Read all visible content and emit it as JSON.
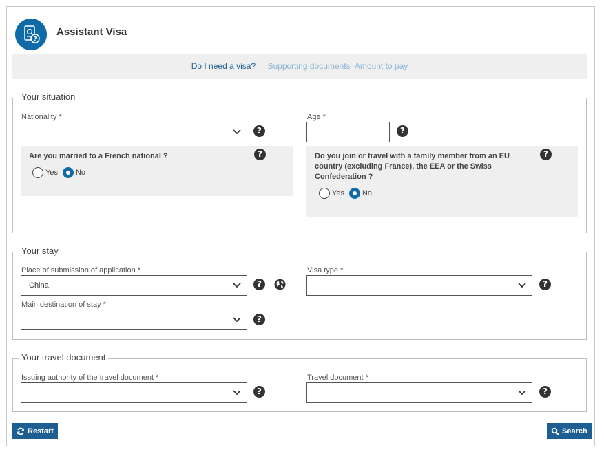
{
  "header": {
    "title": "Assistant Visa",
    "logo_icon": "passport-help-icon",
    "brand_color": "#0f6ba7"
  },
  "tabs": [
    {
      "label": "Do I need a visa?",
      "active": true
    },
    {
      "label": "Supporting documents",
      "active": false
    },
    {
      "label": "Amount to pay",
      "active": false
    }
  ],
  "situation": {
    "legend": "Your situation",
    "nationality_label": "Nationality *",
    "nationality_value": "",
    "age_label": "Age *",
    "age_value": "",
    "married_question": "Are you married to a French national ?",
    "married_options": {
      "yes": "Yes",
      "no": "No",
      "selected": "No"
    },
    "family_question_line1": "Do you join or travel with a family member from an EU",
    "family_question_line2": "country (excluding France), the EEA or the Swiss",
    "family_question_line3": "Confederation ?",
    "family_options": {
      "yes": "Yes",
      "no": "No",
      "selected": "No"
    }
  },
  "stay": {
    "legend": "Your stay",
    "place_label": "Place of submission of application *",
    "place_value": "China",
    "visa_type_label": "Visa type *",
    "visa_type_value": "",
    "destination_label": "Main destination of stay *",
    "destination_value": ""
  },
  "travel": {
    "legend": "Your travel document",
    "authority_label": "Issuing authority of the travel document *",
    "authority_value": "",
    "document_label": "Travel document *",
    "document_value": ""
  },
  "actions": {
    "restart_label": "Restart",
    "search_label": "Search"
  },
  "help_glyph": "?"
}
